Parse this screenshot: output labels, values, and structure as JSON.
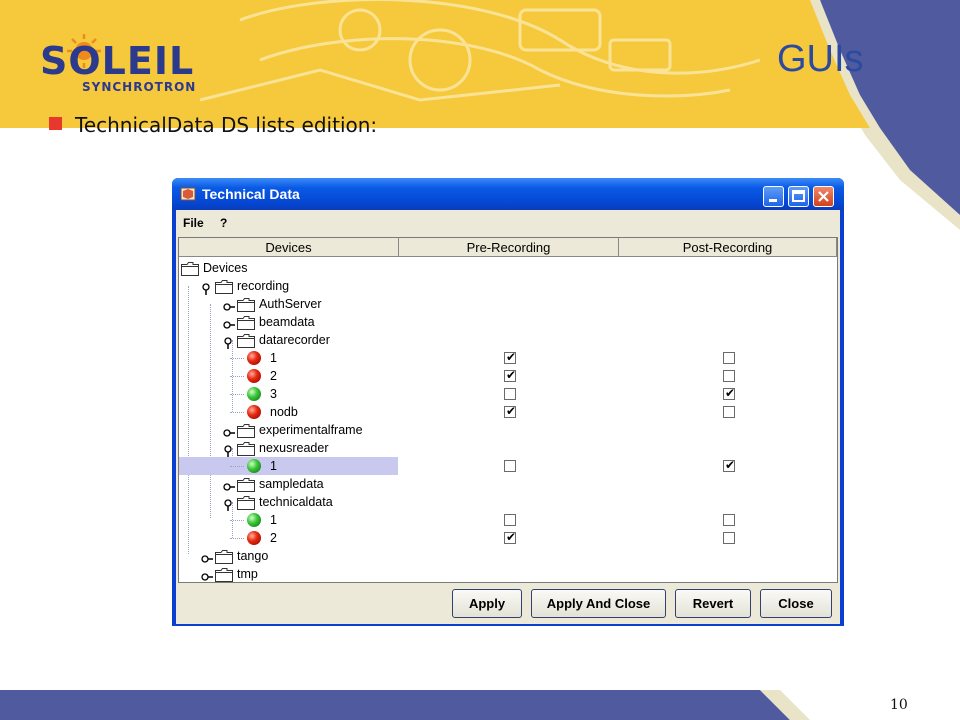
{
  "slide": {
    "logo_text": "SOLEIL",
    "logo_subtext": "SYNCHROTRON",
    "title": "GUIs",
    "bullet": "TechnicalData DS lists edition:",
    "page_number": "10"
  },
  "window": {
    "title": "Technical Data",
    "menu": [
      "File",
      "?"
    ],
    "columns": [
      "Devices",
      "Pre-Recording",
      "Post-Recording"
    ]
  },
  "tree": [
    {
      "label": "Devices",
      "depth": 0,
      "kind": "folder",
      "toggle": "none"
    },
    {
      "label": "recording",
      "depth": 1,
      "kind": "folder",
      "toggle": "expanded"
    },
    {
      "label": "AuthServer",
      "depth": 2,
      "kind": "folder",
      "toggle": "collapsed"
    },
    {
      "label": "beamdata",
      "depth": 2,
      "kind": "folder",
      "toggle": "collapsed"
    },
    {
      "label": "datarecorder",
      "depth": 2,
      "kind": "folder",
      "toggle": "expanded"
    },
    {
      "label": "1",
      "depth": 3,
      "kind": "led",
      "status": "red",
      "pre": true,
      "post": false
    },
    {
      "label": "2",
      "depth": 3,
      "kind": "led",
      "status": "red",
      "pre": true,
      "post": false
    },
    {
      "label": "3",
      "depth": 3,
      "kind": "led",
      "status": "green",
      "pre": false,
      "post": true
    },
    {
      "label": "nodb",
      "depth": 3,
      "kind": "led",
      "status": "red",
      "pre": true,
      "post": false
    },
    {
      "label": "experimentalframe",
      "depth": 2,
      "kind": "folder",
      "toggle": "collapsed"
    },
    {
      "label": "nexusreader",
      "depth": 2,
      "kind": "folder",
      "toggle": "expanded"
    },
    {
      "label": "1",
      "depth": 3,
      "kind": "led",
      "status": "green",
      "pre": false,
      "post": true,
      "selected": true
    },
    {
      "label": "sampledata",
      "depth": 2,
      "kind": "folder",
      "toggle": "collapsed"
    },
    {
      "label": "technicaldata",
      "depth": 2,
      "kind": "folder",
      "toggle": "expanded"
    },
    {
      "label": "1",
      "depth": 3,
      "kind": "led",
      "status": "green",
      "pre": false,
      "post": false
    },
    {
      "label": "2",
      "depth": 3,
      "kind": "led",
      "status": "red",
      "pre": true,
      "post": false
    },
    {
      "label": "tango",
      "depth": 1,
      "kind": "folder",
      "toggle": "collapsed"
    },
    {
      "label": "tmp",
      "depth": 1,
      "kind": "folder",
      "toggle": "collapsed"
    }
  ],
  "buttons": {
    "apply": "Apply",
    "apply_close": "Apply And Close",
    "revert": "Revert",
    "close": "Close"
  },
  "colors": {
    "slide_blue": "#4f5b9e",
    "slide_yellow": "#f6c83c",
    "title_blue": "#2b4aa0",
    "bullet_red": "#e8372c",
    "xp_titlebar": "#0546d2",
    "selection": "#c9c9f0"
  }
}
